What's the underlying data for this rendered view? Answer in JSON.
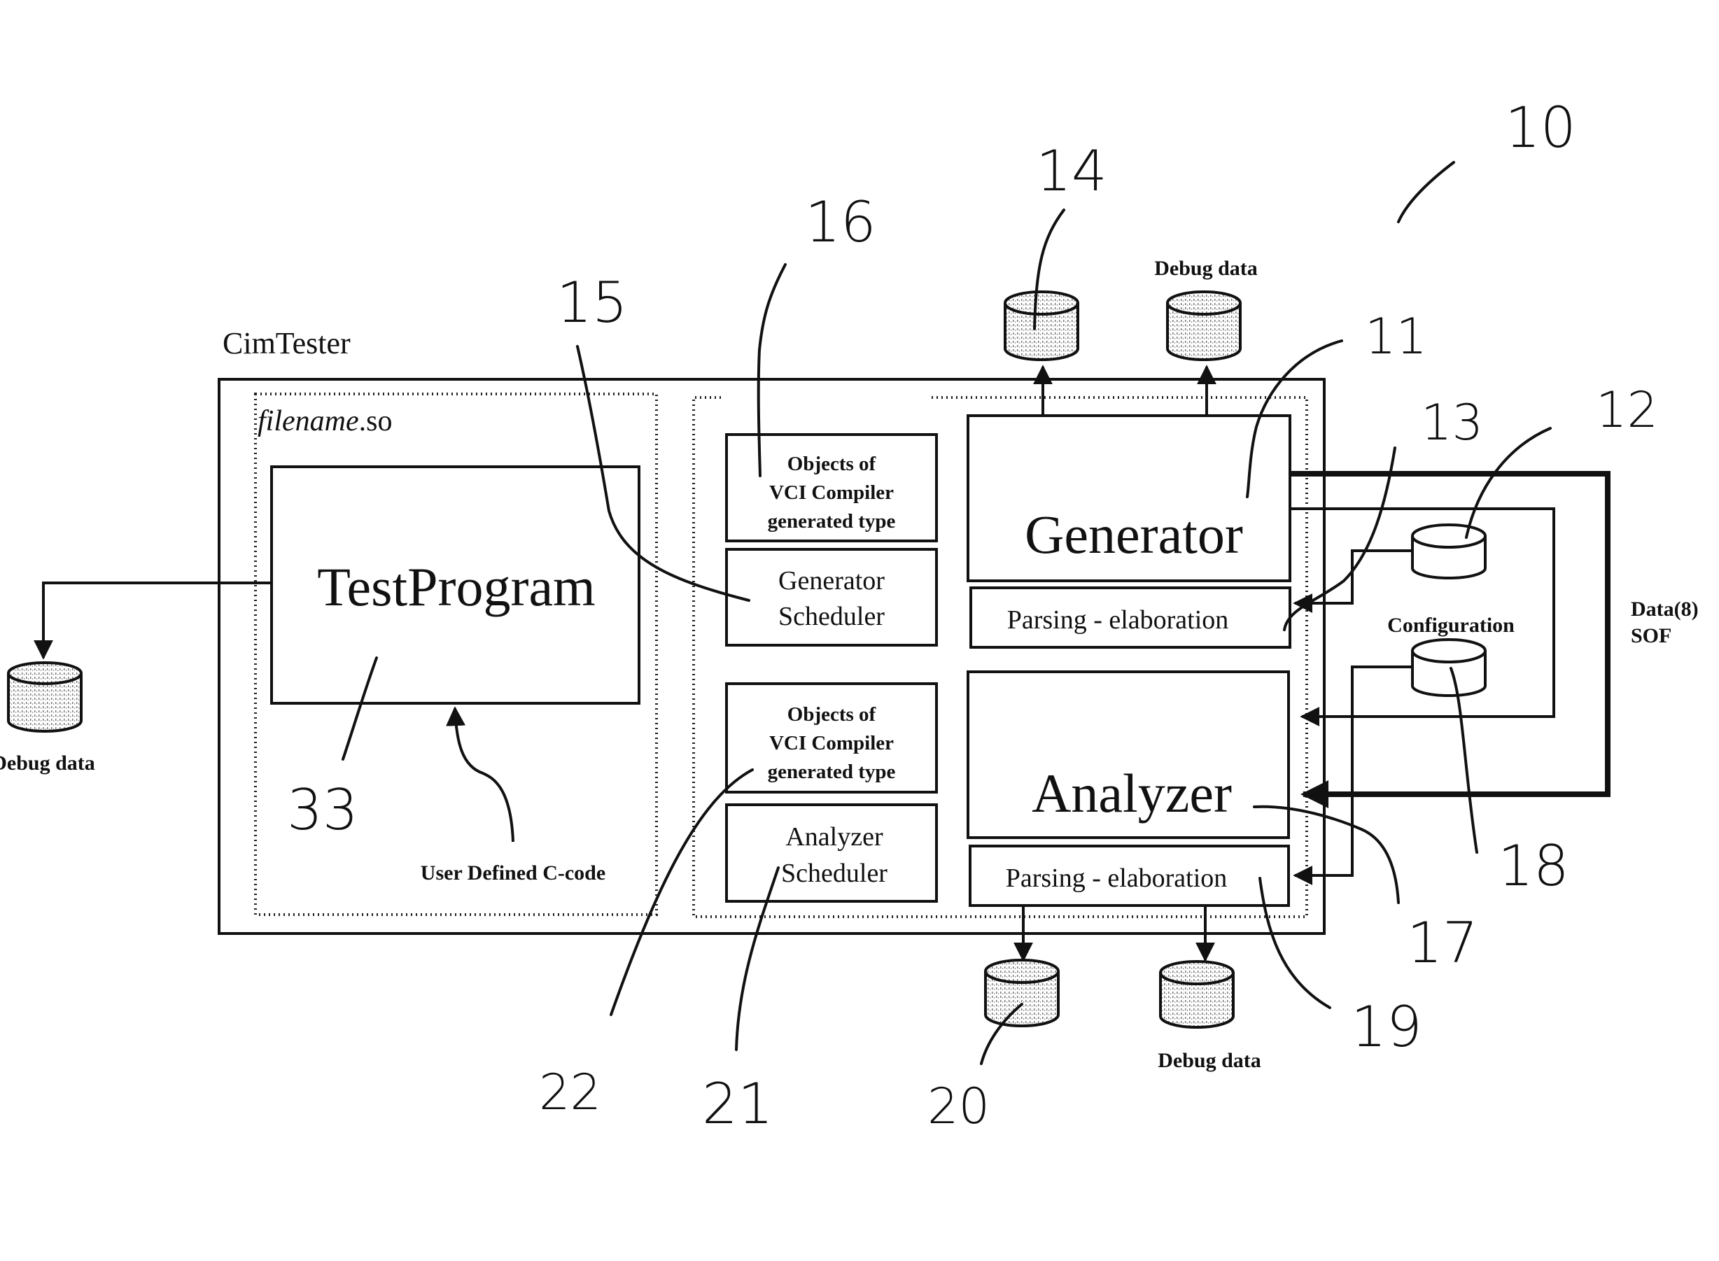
{
  "diagram": {
    "system_label": "CimTester",
    "module_label_italic": "filename",
    "module_label_suffix": ".so",
    "test_program": "TestProgram",
    "user_code": "User Defined C-code",
    "objects_top": [
      "Objects of",
      "VCI Compiler",
      "generated type"
    ],
    "gen_scheduler": [
      "Generator",
      "Scheduler"
    ],
    "objects_bottom": [
      "Objects of",
      "VCI Compiler",
      "generated type"
    ],
    "ana_scheduler": [
      "Analyzer",
      "Scheduler"
    ],
    "generator": "Generator",
    "analyzer": "Analyzer",
    "parsing_top": "Parsing - elaboration",
    "parsing_bottom": "Parsing - elaboration",
    "configuration": "Configuration",
    "data_sof": [
      "Data(8)",
      "SOF"
    ],
    "debug_left": "Debug data",
    "debug_top": "Debug data",
    "debug_bottom": "Debug data"
  },
  "reference_numerals": {
    "r10": "10",
    "r11": "11",
    "r12": "12",
    "r13": "13",
    "r14": "14",
    "r15": "15",
    "r16": "16",
    "r17": "17",
    "r18": "18",
    "r19": "19",
    "r20": "20",
    "r21": "21",
    "r22": "22",
    "r33": "33"
  }
}
